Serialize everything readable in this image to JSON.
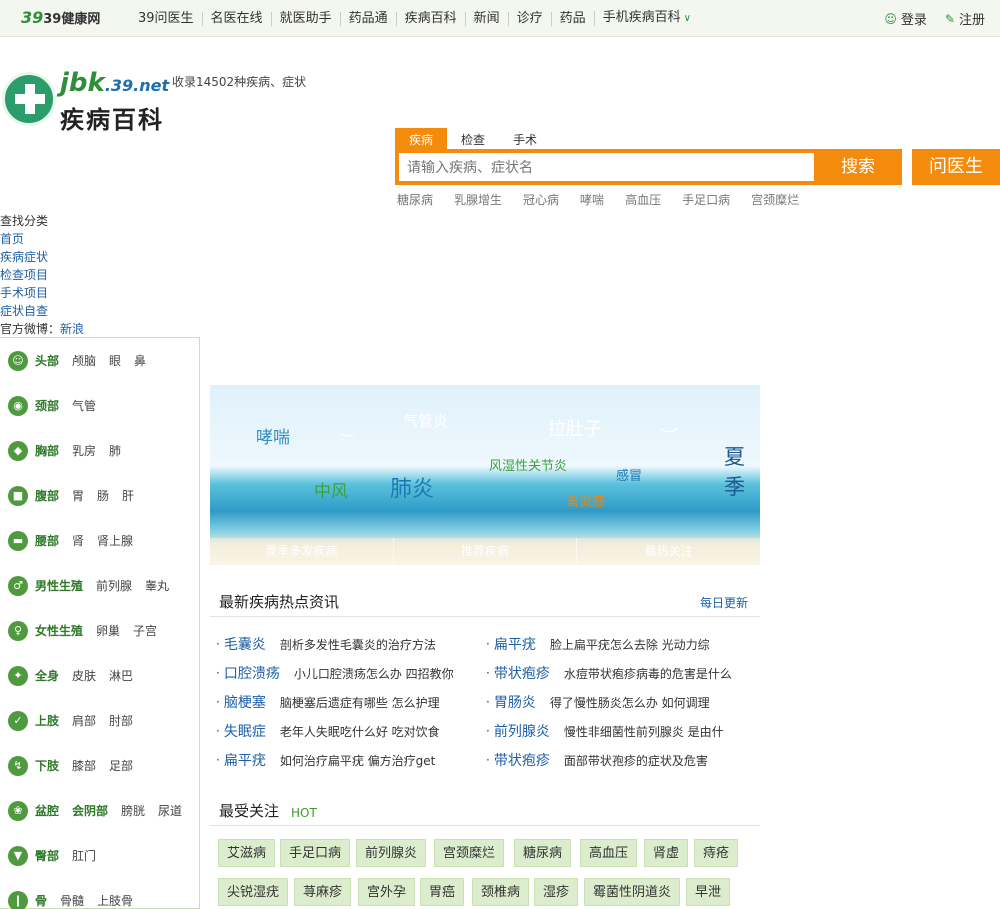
{
  "topbar": {
    "logo": "39健康网",
    "nav": [
      "39问医生",
      "名医在线",
      "就医助手",
      "药品通",
      "疾病百科",
      "新闻",
      "诊疗",
      "药品",
      "手机疾病百科"
    ],
    "login": "登录",
    "register": "注册"
  },
  "brand": {
    "domain": "jbk",
    "domain_suffix": ".39.net",
    "name": "疾病百科",
    "tagline": "收录14502种疾病、症状"
  },
  "search": {
    "tabs": [
      "疾病",
      "检查",
      "手术"
    ],
    "placeholder": "请输入疾病、症状名",
    "search_button": "搜索",
    "ask_button": "问医生",
    "hotwords": [
      "糖尿病",
      "乳腺增生",
      "冠心病",
      "哮喘",
      "高血压",
      "手足口病",
      "宫颈糜烂"
    ]
  },
  "findcat": {
    "title": "查找分类",
    "links": [
      "首页",
      "疾病症状",
      "检查项目",
      "手术项目",
      "症状自查"
    ],
    "weibo_label": "官方微博：",
    "weibo_link": "新浪"
  },
  "sidebar": [
    {
      "cat": "头部",
      "subs": [
        "颅脑",
        "眼",
        "鼻"
      ]
    },
    {
      "cat": "颈部",
      "subs": [
        "气管"
      ]
    },
    {
      "cat": "胸部",
      "subs": [
        "乳房",
        "肺"
      ]
    },
    {
      "cat": "腹部",
      "subs": [
        "胃",
        "肠",
        "肝"
      ]
    },
    {
      "cat": "腰部",
      "subs": [
        "肾",
        "肾上腺"
      ]
    },
    {
      "cat": "男性生殖",
      "subs": [
        "前列腺",
        "睾丸"
      ]
    },
    {
      "cat": "女性生殖",
      "subs": [
        "卵巢",
        "子宫"
      ]
    },
    {
      "cat": "全身",
      "subs": [
        "皮肤",
        "淋巴"
      ]
    },
    {
      "cat": "上肢",
      "subs": [
        "肩部",
        "肘部"
      ]
    },
    {
      "cat": "下肢",
      "subs": [
        "膝部",
        "足部"
      ]
    },
    {
      "cat": "盆腔",
      "subs": [
        "会阴部",
        "膀胱",
        "尿道"
      ]
    },
    {
      "cat": "臀部",
      "subs": [
        "肛门"
      ]
    },
    {
      "cat": "骨",
      "subs": [
        "骨髓",
        "上肢骨"
      ]
    }
  ],
  "banner": {
    "words": [
      "哮喘",
      "气管炎",
      "拉肚子",
      "中风",
      "肺炎",
      "风湿性关节炎",
      "感冒",
      "禽流感",
      "夏",
      "季"
    ],
    "tabs": [
      "夏季多发疾病",
      "推荐疾病",
      "最热关注"
    ]
  },
  "news": {
    "title": "最新疾病热点资讯",
    "more": "每日更新",
    "left": [
      {
        "kw": "毛囊炎",
        "txt": "剖析多发性毛囊炎的治疗方法"
      },
      {
        "kw": "口腔溃疡",
        "txt": "小儿口腔溃疡怎么办 四招教你"
      },
      {
        "kw": "脑梗塞",
        "txt": "脑梗塞后遗症有哪些 怎么护理"
      },
      {
        "kw": "失眠症",
        "txt": "老年人失眠吃什么好 吃对饮食"
      },
      {
        "kw": "扁平疣",
        "txt": "如何治疗扁平疣 偏方治疗get"
      }
    ],
    "right": [
      {
        "kw": "扁平疣",
        "txt": "脸上扁平疣怎么去除 光动力综"
      },
      {
        "kw": "带状疱疹",
        "txt": "水痘带状疱疹病毒的危害是什么"
      },
      {
        "kw": "胃肠炎",
        "txt": "得了慢性肠炎怎么办 如何调理"
      },
      {
        "kw": "前列腺炎",
        "txt": "慢性非细菌性前列腺炎 是由什"
      },
      {
        "kw": "带状疱疹",
        "txt": "面部带状孢疹的症状及危害"
      }
    ]
  },
  "follow": {
    "title": "最受关注",
    "hot": "HOT",
    "row1": [
      "艾滋病",
      "手足口病",
      "前列腺炎",
      "宫颈糜烂",
      "糖尿病",
      "高血压",
      "肾虚",
      "痔疮"
    ],
    "row2": [
      "尖锐湿疣",
      "荨麻疹",
      "宫外孕",
      "胃癌",
      "颈椎病",
      "湿疹",
      "霉菌性阴道炎",
      "早泄"
    ]
  }
}
